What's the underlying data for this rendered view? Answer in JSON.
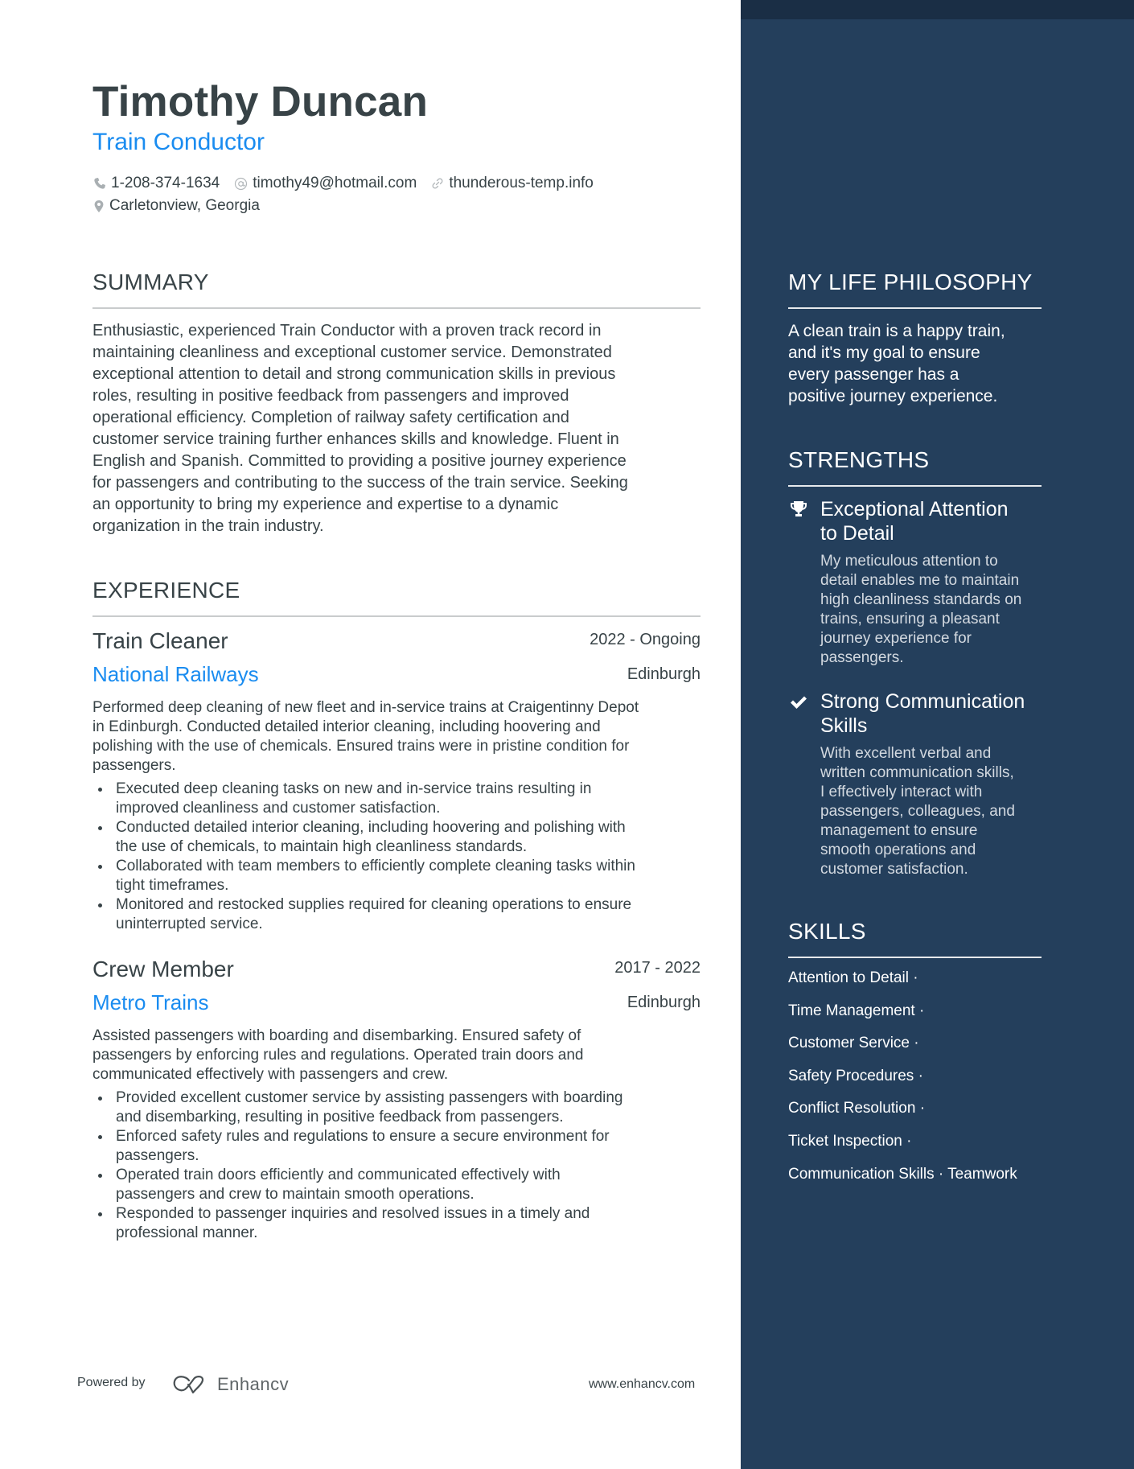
{
  "header": {
    "name": "Timothy Duncan",
    "title": "Train Conductor",
    "contacts": {
      "phone": {
        "icon": "phone-icon",
        "value": "1-208-374-1634"
      },
      "email": {
        "icon": "at-icon",
        "value": "timothy49@hotmail.com"
      },
      "website": {
        "icon": "link-icon",
        "value": "thunderous-temp.info"
      },
      "location": {
        "icon": "location-pin-icon",
        "value": "Carletonview, Georgia"
      }
    }
  },
  "summary": {
    "heading": "SUMMARY",
    "lines": [
      "Enthusiastic, experienced Train Conductor with a proven track record in",
      "maintaining cleanliness and exceptional customer service. Demonstrated",
      "exceptional attention to detail and strong communication skills in previous",
      "roles, resulting in positive feedback from passengers and improved",
      "operational efficiency. Completion of railway safety certification and",
      "customer service training further enhances skills and knowledge. Fluent in",
      "English and Spanish. Committed to providing a positive journey experience",
      "for passengers and contributing to the success of the train service. Seeking",
      "an opportunity to bring my experience and expertise to a dynamic",
      "organization in the train industry."
    ]
  },
  "experience": {
    "heading": "EXPERIENCE",
    "jobs": [
      {
        "title": "Train Cleaner",
        "dates": "2022 - Ongoing",
        "company": "National Railways",
        "location": "Edinburgh",
        "description_lines": [
          "Performed deep cleaning of new fleet and in-service trains at Craigentinny Depot",
          "in Edinburgh. Conducted detailed interior cleaning, including hoovering and",
          "polishing with the use of chemicals. Ensured trains were in pristine condition for",
          "passengers."
        ],
        "bullets": [
          [
            "Executed deep cleaning tasks on new and in-service trains resulting in",
            "improved cleanliness and customer satisfaction."
          ],
          [
            "Conducted detailed interior cleaning, including hoovering and polishing with",
            "the use of chemicals, to maintain high cleanliness standards."
          ],
          [
            "Collaborated with team members to efficiently complete cleaning tasks within",
            "tight timeframes."
          ],
          [
            "Monitored and restocked supplies required for cleaning operations to ensure",
            "uninterrupted service."
          ]
        ]
      },
      {
        "title": "Crew Member",
        "dates": "2017 - 2022",
        "company": "Metro Trains",
        "location": "Edinburgh",
        "description_lines": [
          "Assisted passengers with boarding and disembarking. Ensured safety of",
          "passengers by enforcing rules and regulations. Operated train doors and",
          "communicated effectively with passengers and crew."
        ],
        "bullets": [
          [
            "Provided excellent customer service by assisting passengers with boarding",
            "and disembarking, resulting in positive feedback from passengers."
          ],
          [
            "Enforced safety rules and regulations to ensure a secure environment for",
            "passengers."
          ],
          [
            "Operated train doors efficiently and communicated effectively with",
            "passengers and crew to maintain smooth operations."
          ],
          [
            "Responded to passenger inquiries and resolved issues in a timely and",
            "professional manner."
          ]
        ]
      }
    ]
  },
  "philosophy": {
    "heading": "MY LIFE PHILOSOPHY",
    "lines": [
      "A clean train is a happy train,",
      "and it's my goal to ensure",
      "every passenger has a",
      "positive journey experience."
    ]
  },
  "strengths": {
    "heading": "STRENGTHS",
    "items": [
      {
        "icon": "trophy-icon",
        "title_lines": [
          "Exceptional Attention",
          "to Detail"
        ],
        "description_lines": [
          "My meticulous attention to",
          "detail enables me to maintain",
          "high cleanliness standards on",
          "trains, ensuring a pleasant",
          "journey experience for",
          "passengers."
        ]
      },
      {
        "icon": "checkmark-icon",
        "title_lines": [
          "Strong Communication",
          "Skills"
        ],
        "description_lines": [
          "With excellent verbal and",
          "written communication skills,",
          "I effectively interact with",
          "passengers, colleagues, and",
          "management to ensure",
          "smooth operations and",
          "customer satisfaction."
        ]
      }
    ]
  },
  "skills": {
    "heading": "SKILLS",
    "rows": [
      "Attention to Detail ·",
      "Time Management ·",
      "Customer Service ·",
      "Safety Procedures ·",
      "Conflict Resolution ·",
      "Ticket Inspection ·",
      "Communication Skills · Teamwork"
    ]
  },
  "footer": {
    "powered_by": "Powered by",
    "brand": "Enhancv",
    "url": "www.enhancv.com"
  },
  "colors": {
    "accent": "#1a8cf0",
    "text": "#384347",
    "panel": "#243f5c",
    "panel_strip": "#1a2e45"
  }
}
